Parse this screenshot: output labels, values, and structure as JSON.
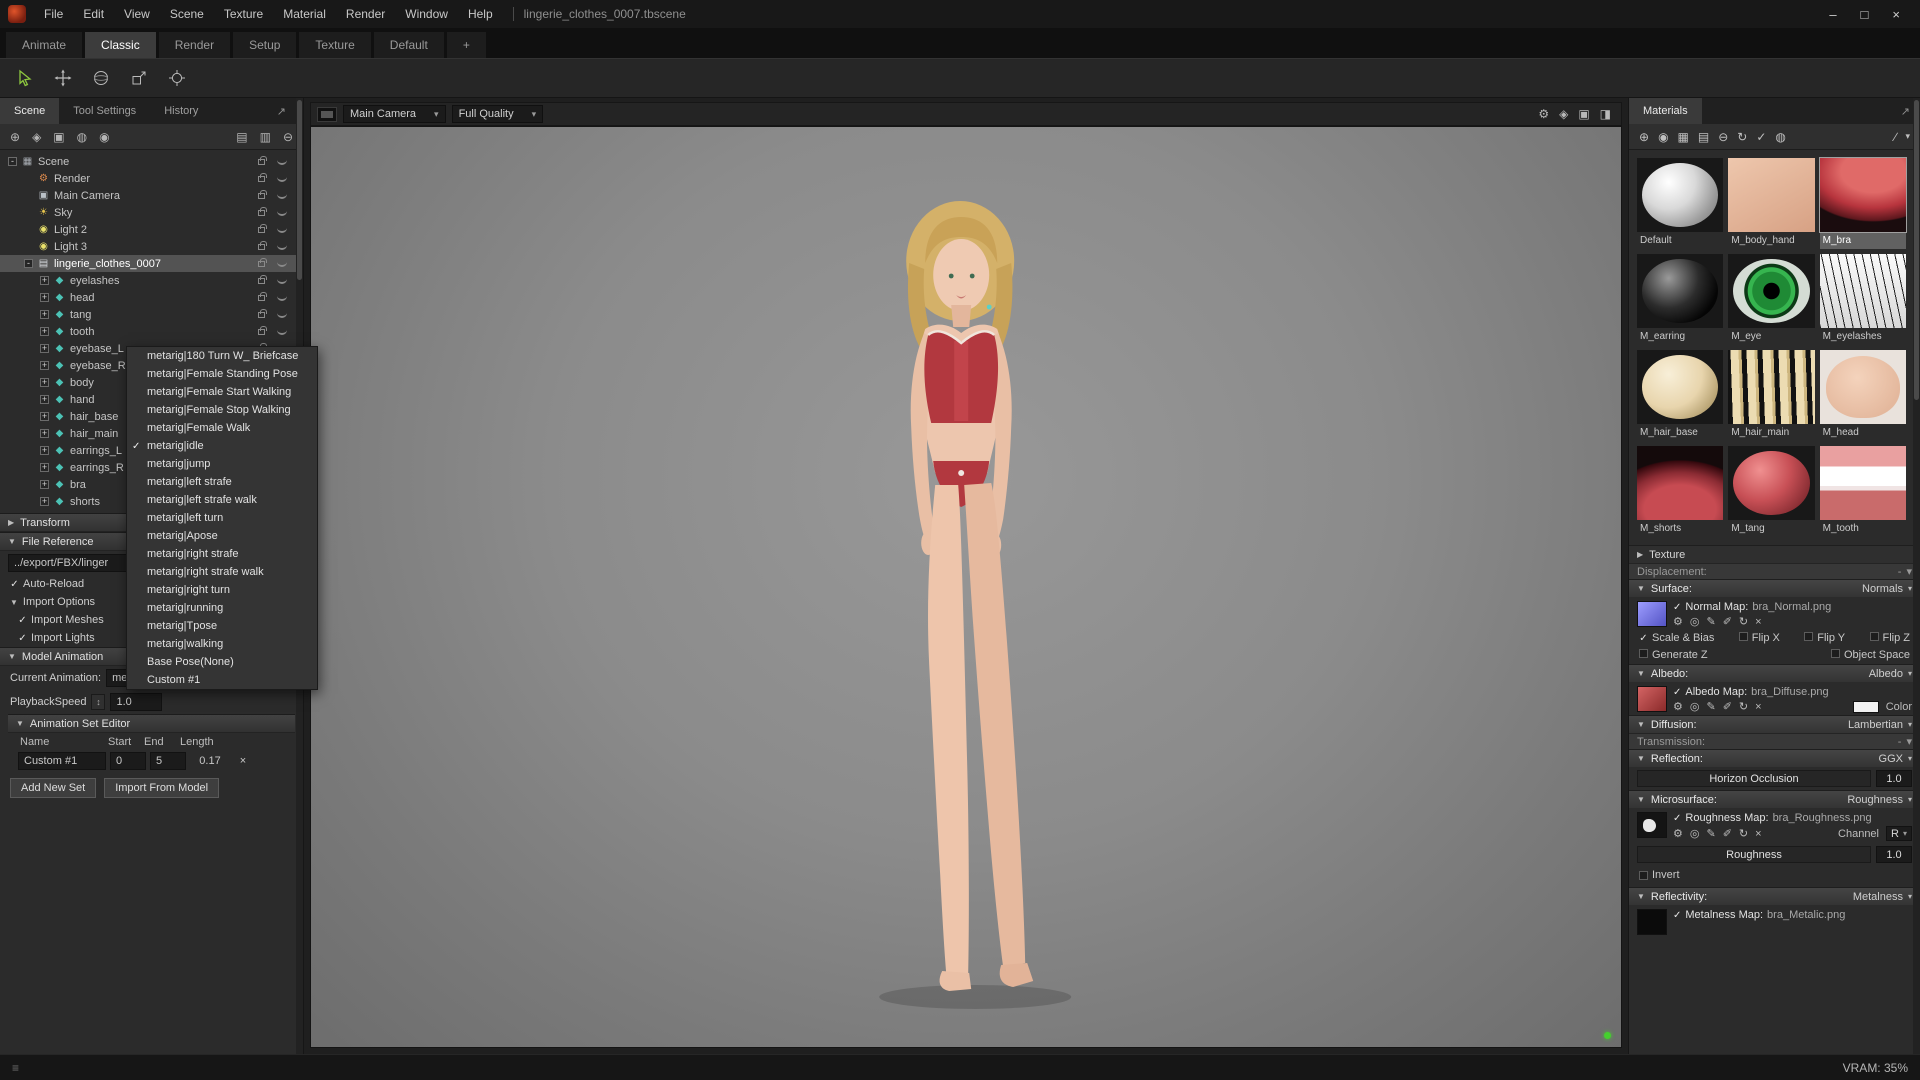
{
  "window": {
    "menus": [
      "File",
      "Edit",
      "View",
      "Scene",
      "Texture",
      "Material",
      "Render",
      "Window",
      "Help"
    ],
    "filename": "lingerie_clothes_0007.tbscene"
  },
  "workspace_tabs": [
    {
      "label": "Animate",
      "active": false
    },
    {
      "label": "Classic",
      "active": true
    },
    {
      "label": "Render",
      "active": false
    },
    {
      "label": "Setup",
      "active": false
    },
    {
      "label": "Texture",
      "active": false
    },
    {
      "label": "Default",
      "active": false
    },
    {
      "label": "+",
      "active": false
    }
  ],
  "left_panel": {
    "tabs": [
      {
        "label": "Scene",
        "active": true
      },
      {
        "label": "Tool Settings",
        "active": false
      },
      {
        "label": "History",
        "active": false
      }
    ],
    "tree": [
      {
        "label": "Scene",
        "icon": "scene",
        "depth": 0,
        "exp": "-",
        "selected": false
      },
      {
        "label": "Render",
        "icon": "render",
        "depth": 1,
        "exp": "",
        "selected": false
      },
      {
        "label": "Main Camera",
        "icon": "camera",
        "depth": 1,
        "exp": "",
        "selected": false
      },
      {
        "label": "Sky",
        "icon": "sky",
        "depth": 1,
        "exp": "",
        "selected": false
      },
      {
        "label": "Light 2",
        "icon": "light",
        "depth": 1,
        "exp": "",
        "selected": false
      },
      {
        "label": "Light 3",
        "icon": "light",
        "depth": 1,
        "exp": "",
        "selected": false
      },
      {
        "label": "lingerie_clothes_0007",
        "icon": "model",
        "depth": 1,
        "exp": "-",
        "selected": true
      },
      {
        "label": "eyelashes",
        "icon": "mesh",
        "depth": 2,
        "exp": "+",
        "selected": false
      },
      {
        "label": "head",
        "icon": "mesh",
        "depth": 2,
        "exp": "+",
        "selected": false
      },
      {
        "label": "tang",
        "icon": "mesh",
        "depth": 2,
        "exp": "+",
        "selected": false
      },
      {
        "label": "tooth",
        "icon": "mesh",
        "depth": 2,
        "exp": "+",
        "selected": false
      },
      {
        "label": "eyebase_L",
        "icon": "mesh",
        "depth": 2,
        "exp": "+",
        "selected": false
      },
      {
        "label": "eyebase_R",
        "icon": "mesh",
        "depth": 2,
        "exp": "+",
        "selected": false
      },
      {
        "label": "body",
        "icon": "mesh",
        "depth": 2,
        "exp": "+",
        "selected": false
      },
      {
        "label": "hand",
        "icon": "mesh",
        "depth": 2,
        "exp": "+",
        "selected": false
      },
      {
        "label": "hair_base",
        "icon": "mesh",
        "depth": 2,
        "exp": "+",
        "selected": false
      },
      {
        "label": "hair_main",
        "icon": "mesh",
        "depth": 2,
        "exp": "+",
        "selected": false
      },
      {
        "label": "earrings_L",
        "icon": "mesh",
        "depth": 2,
        "exp": "+",
        "selected": false
      },
      {
        "label": "earrings_R",
        "icon": "mesh",
        "depth": 2,
        "exp": "+",
        "selected": false
      },
      {
        "label": "bra",
        "icon": "mesh",
        "depth": 2,
        "exp": "+",
        "selected": false
      },
      {
        "label": "shorts",
        "icon": "mesh",
        "depth": 2,
        "exp": "+",
        "selected": false
      }
    ],
    "transform_label": "Transform",
    "file_reference": {
      "label": "File Reference",
      "path": "../export/FBX/linger",
      "auto_reload": "Auto-Reload",
      "import_options": "Import Options",
      "import_meshes": "Import Meshes",
      "import_lights": "Import Lights"
    },
    "model_animation": {
      "label": "Model Animation",
      "current_label": "Current Animation:",
      "current_value": "metarig|idle",
      "playback_label": "PlaybackSpeed",
      "playback_value": "1.0",
      "set_editor_label": "Animation Set Editor",
      "table_headers": [
        "Name",
        "Start",
        "End",
        "Length"
      ],
      "sets": [
        {
          "name": "Custom #1",
          "start": "0",
          "end": "5",
          "length": "0.17"
        }
      ],
      "add_button": "Add New Set",
      "import_button": "Import From Model"
    }
  },
  "animation_menu": {
    "items": [
      {
        "label": "metarig|180 Turn W_ Briefcase",
        "checked": false
      },
      {
        "label": "metarig|Female Standing Pose",
        "checked": false
      },
      {
        "label": "metarig|Female Start Walking",
        "checked": false
      },
      {
        "label": "metarig|Female Stop Walking",
        "checked": false
      },
      {
        "label": "metarig|Female Walk",
        "checked": false
      },
      {
        "label": "metarig|idle",
        "checked": true
      },
      {
        "label": "metarig|jump",
        "checked": false
      },
      {
        "label": "metarig|left strafe",
        "checked": false
      },
      {
        "label": "metarig|left strafe walk",
        "checked": false
      },
      {
        "label": "metarig|left turn",
        "checked": false
      },
      {
        "label": "metarig|Apose",
        "checked": false
      },
      {
        "label": "metarig|right strafe",
        "checked": false
      },
      {
        "label": "metarig|right strafe walk",
        "checked": false
      },
      {
        "label": "metarig|right turn",
        "checked": false
      },
      {
        "label": "metarig|running",
        "checked": false
      },
      {
        "label": "metarig|Tpose",
        "checked": false
      },
      {
        "label": "metarig|walking",
        "checked": false
      },
      {
        "label": "Base Pose(None)",
        "checked": false
      },
      {
        "label": "Custom #1",
        "checked": false
      }
    ]
  },
  "viewport": {
    "camera": "Main Camera",
    "quality": "Full Quality"
  },
  "materials_panel": {
    "title": "Materials",
    "materials": [
      {
        "name": "Default",
        "thumb": "default",
        "selected": false
      },
      {
        "name": "M_body_hand",
        "thumb": "skin",
        "selected": false
      },
      {
        "name": "M_bra",
        "thumb": "bra",
        "selected": true
      },
      {
        "name": "M_earring",
        "thumb": "black",
        "selected": false
      },
      {
        "name": "M_eye",
        "thumb": "eye",
        "selected": false
      },
      {
        "name": "M_eyelashes",
        "thumb": "lashes",
        "selected": false
      },
      {
        "name": "M_hair_base",
        "thumb": "cream",
        "selected": false
      },
      {
        "name": "M_hair_main",
        "thumb": "hair",
        "selected": false
      },
      {
        "name": "M_head",
        "thumb": "face",
        "selected": false
      },
      {
        "name": "M_shorts",
        "thumb": "shorts",
        "selected": false
      },
      {
        "name": "M_tang",
        "thumb": "red",
        "selected": false
      },
      {
        "name": "M_tooth",
        "thumb": "tooth",
        "selected": false
      }
    ],
    "texture_header": "Texture",
    "displacement": {
      "label": "Displacement:",
      "mode": "-"
    },
    "surface": {
      "label": "Surface:",
      "mode": "Normals",
      "map_label": "Normal Map:",
      "map_file": "bra_Normal.png",
      "checks": [
        {
          "label": "Scale & Bias",
          "checked": true
        },
        {
          "label": "Flip X",
          "checked": false
        },
        {
          "label": "Flip Y",
          "checked": false
        },
        {
          "label": "Flip Z",
          "checked": false
        }
      ],
      "checks2": [
        {
          "label": "Generate Z",
          "checked": false
        },
        {
          "label": "Object Space",
          "checked": false
        }
      ]
    },
    "albedo": {
      "label": "Albedo:",
      "mode": "Albedo",
      "map_label": "Albedo Map:",
      "map_file": "bra_Diffuse.png",
      "color_label": "Color"
    },
    "diffusion": {
      "label": "Diffusion:",
      "mode": "Lambertian"
    },
    "transmission": {
      "label": "Transmission:",
      "mode": "-"
    },
    "reflection": {
      "label": "Reflection:",
      "mode": "GGX",
      "param_label": "Horizon Occlusion",
      "param_value": "1.0"
    },
    "microsurface": {
      "label": "Microsurface:",
      "mode": "Roughness",
      "map_label": "Roughness Map:",
      "map_file": "bra_Roughness.png",
      "channel_label": "Channel",
      "channel_value": "R",
      "param_label": "Roughness",
      "param_value": "1.0",
      "invert_label": "Invert"
    },
    "reflectivity": {
      "label": "Reflectivity:",
      "mode": "Metalness",
      "map_label": "Metalness Map:",
      "map_file": "bra_Metalic.png"
    }
  },
  "status_bar": {
    "vram": "VRAM: 35%"
  },
  "icons": {
    "minimize": "–",
    "maximize": "□",
    "close": "×",
    "undock": "↗",
    "scene": "▦",
    "render": "⚙",
    "camera": "▣",
    "sky": "☀",
    "light": "◉",
    "model": "▤",
    "mesh": "◆",
    "add": "⊕",
    "pin": "◈",
    "snapshot": "▣",
    "world": "◍",
    "ball": "◉",
    "folder": "▤",
    "layers": "▥",
    "trash": "⊖",
    "sync": "↻",
    "apply": "✓",
    "checker": "▦",
    "slash": "∕",
    "settings": "⚙",
    "capture": "◈",
    "layout": "▣",
    "fullscreen": "◨",
    "triangle-down": "▼",
    "dd": "▾",
    "triangle-right": "▶",
    "gear": "⚙",
    "zoom": "◎",
    "paint": "✎",
    "edit": "✐",
    "reload": "↻",
    "clear": "×",
    "check": "✓",
    "stepper": "↕",
    "grip": "≡"
  }
}
